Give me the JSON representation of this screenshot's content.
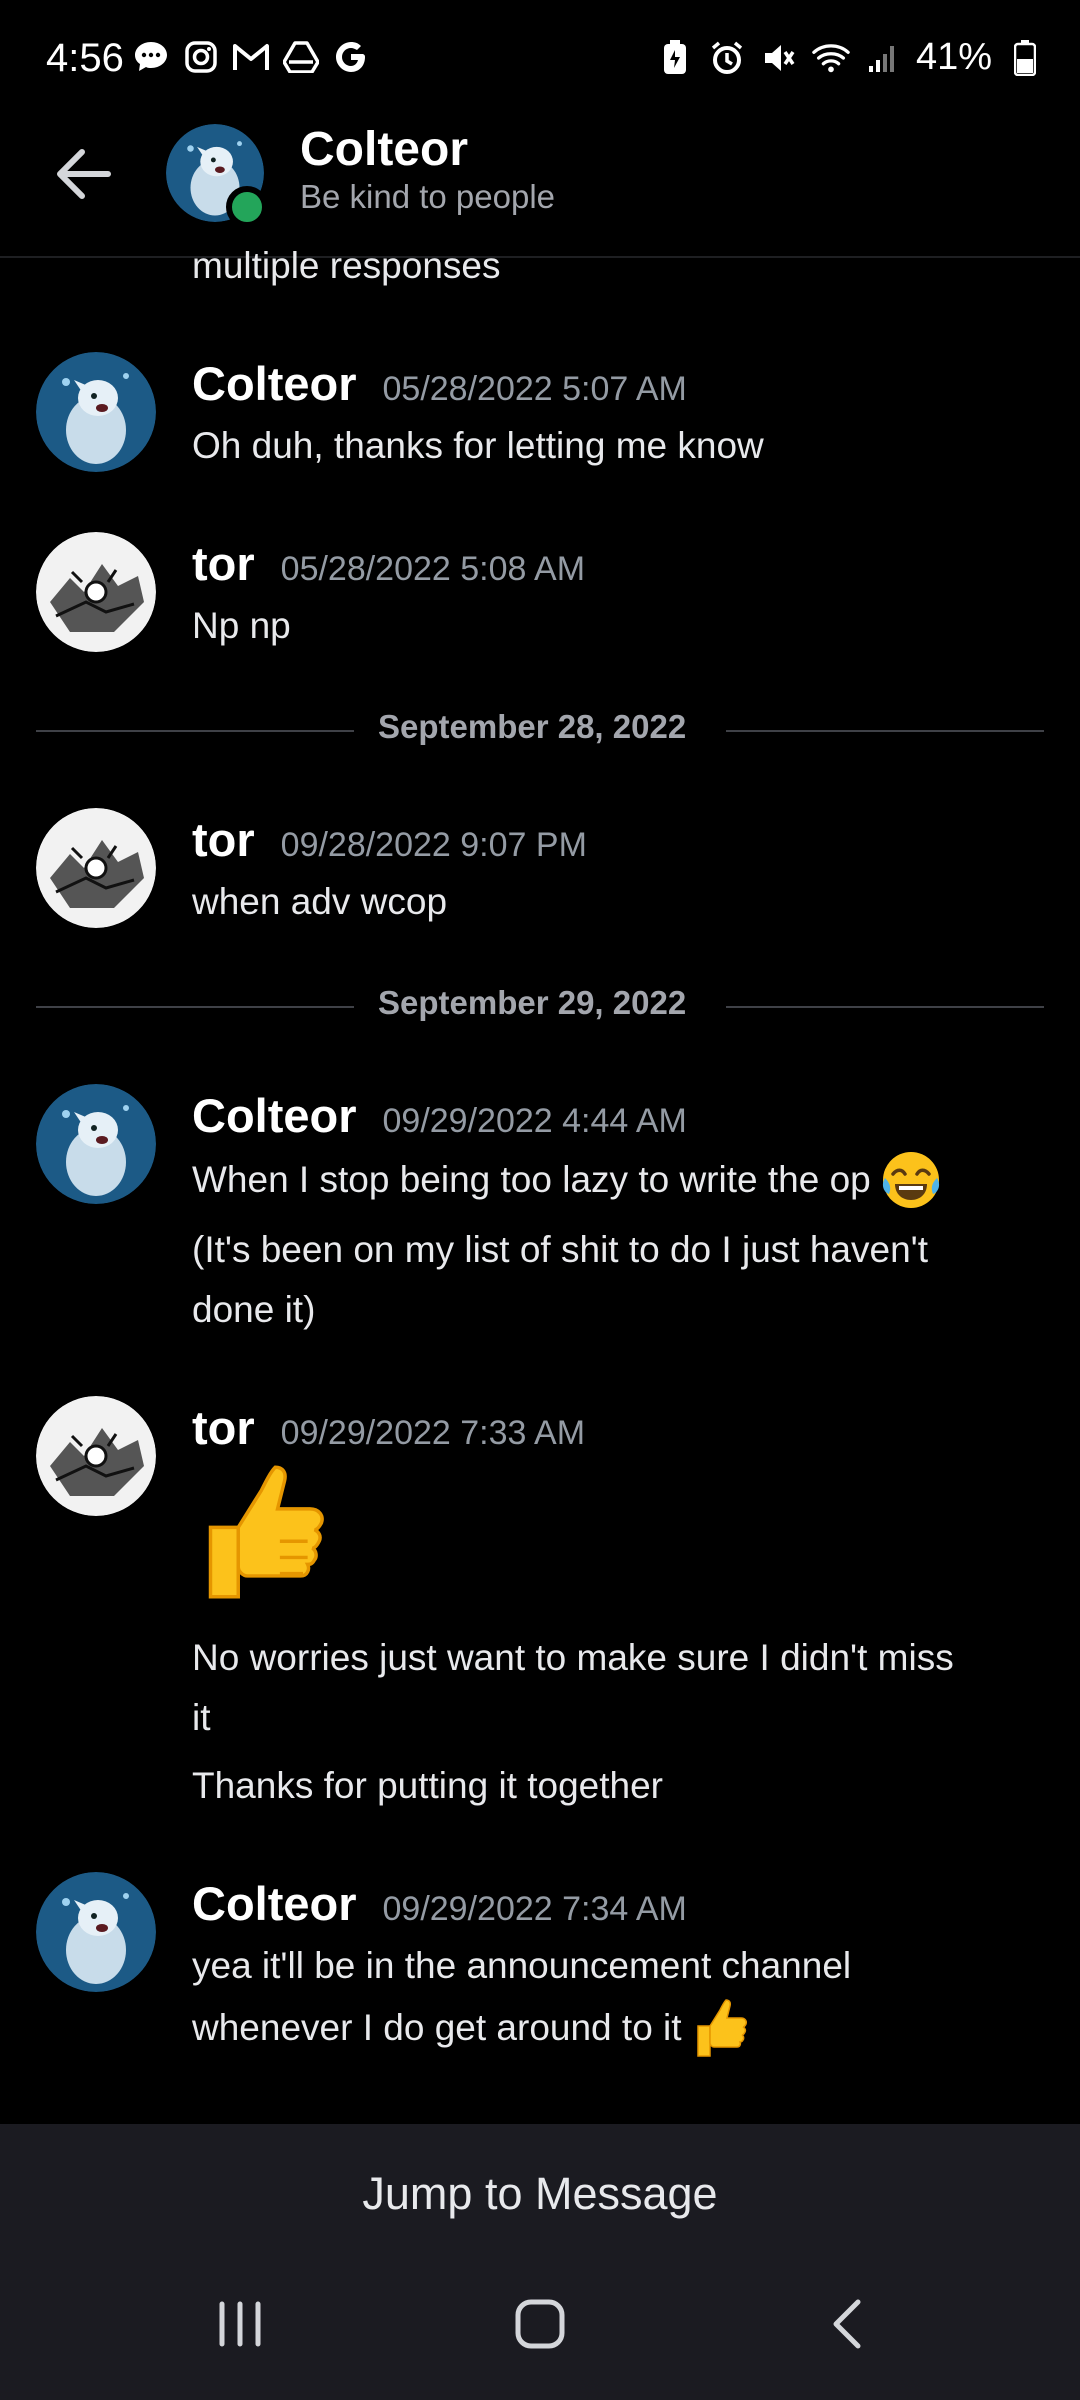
{
  "status_bar": {
    "time": "4:56",
    "battery": "41%",
    "left_icons": [
      "chat-bubble-icon",
      "instagram-icon",
      "gmail-icon",
      "drive-icon",
      "google-icon"
    ],
    "right_icons": [
      "battery-saver-icon",
      "alarm-icon",
      "mute-icon",
      "wifi-icon",
      "signal-icon",
      "battery-icon"
    ]
  },
  "header": {
    "name": "Colteor",
    "status": "Be kind to people"
  },
  "messages": {
    "partial_top": "multiple responses",
    "m1": {
      "user": "Colteor",
      "time": "05/28/2022 5:07 AM",
      "text": "Oh duh, thanks for letting me know"
    },
    "m2": {
      "user": "tor",
      "time": "05/28/2022 5:08 AM",
      "text": "Np np"
    },
    "divider1": "September 28, 2022",
    "m3": {
      "user": "tor",
      "time": "09/28/2022 9:07 PM",
      "text": "when adv wcop"
    },
    "divider2": "September 29, 2022",
    "m4": {
      "user": "Colteor",
      "time": "09/29/2022 4:44 AM",
      "text1": "When I stop being too lazy to write the op",
      "text2a": "(It's been on my list of shit to do I just haven't",
      "text2b": "done it)"
    },
    "m5": {
      "user": "tor",
      "time": "09/29/2022 7:33 AM",
      "text1a": "No worries just want to make sure I didn't miss",
      "text1b": "it",
      "text2": "Thanks for putting it together"
    },
    "m6": {
      "user": "Colteor",
      "time": "09/29/2022 7:34 AM",
      "text_a": "yea it'll be in the announcement channel",
      "text_b": "whenever I do get around to it"
    }
  },
  "jump_bar": {
    "label": "Jump to Message"
  },
  "colors": {
    "background": "#000000",
    "online": "#23a55a",
    "jump_bar": "#1b1b21",
    "muted_text": "#949ba4"
  }
}
